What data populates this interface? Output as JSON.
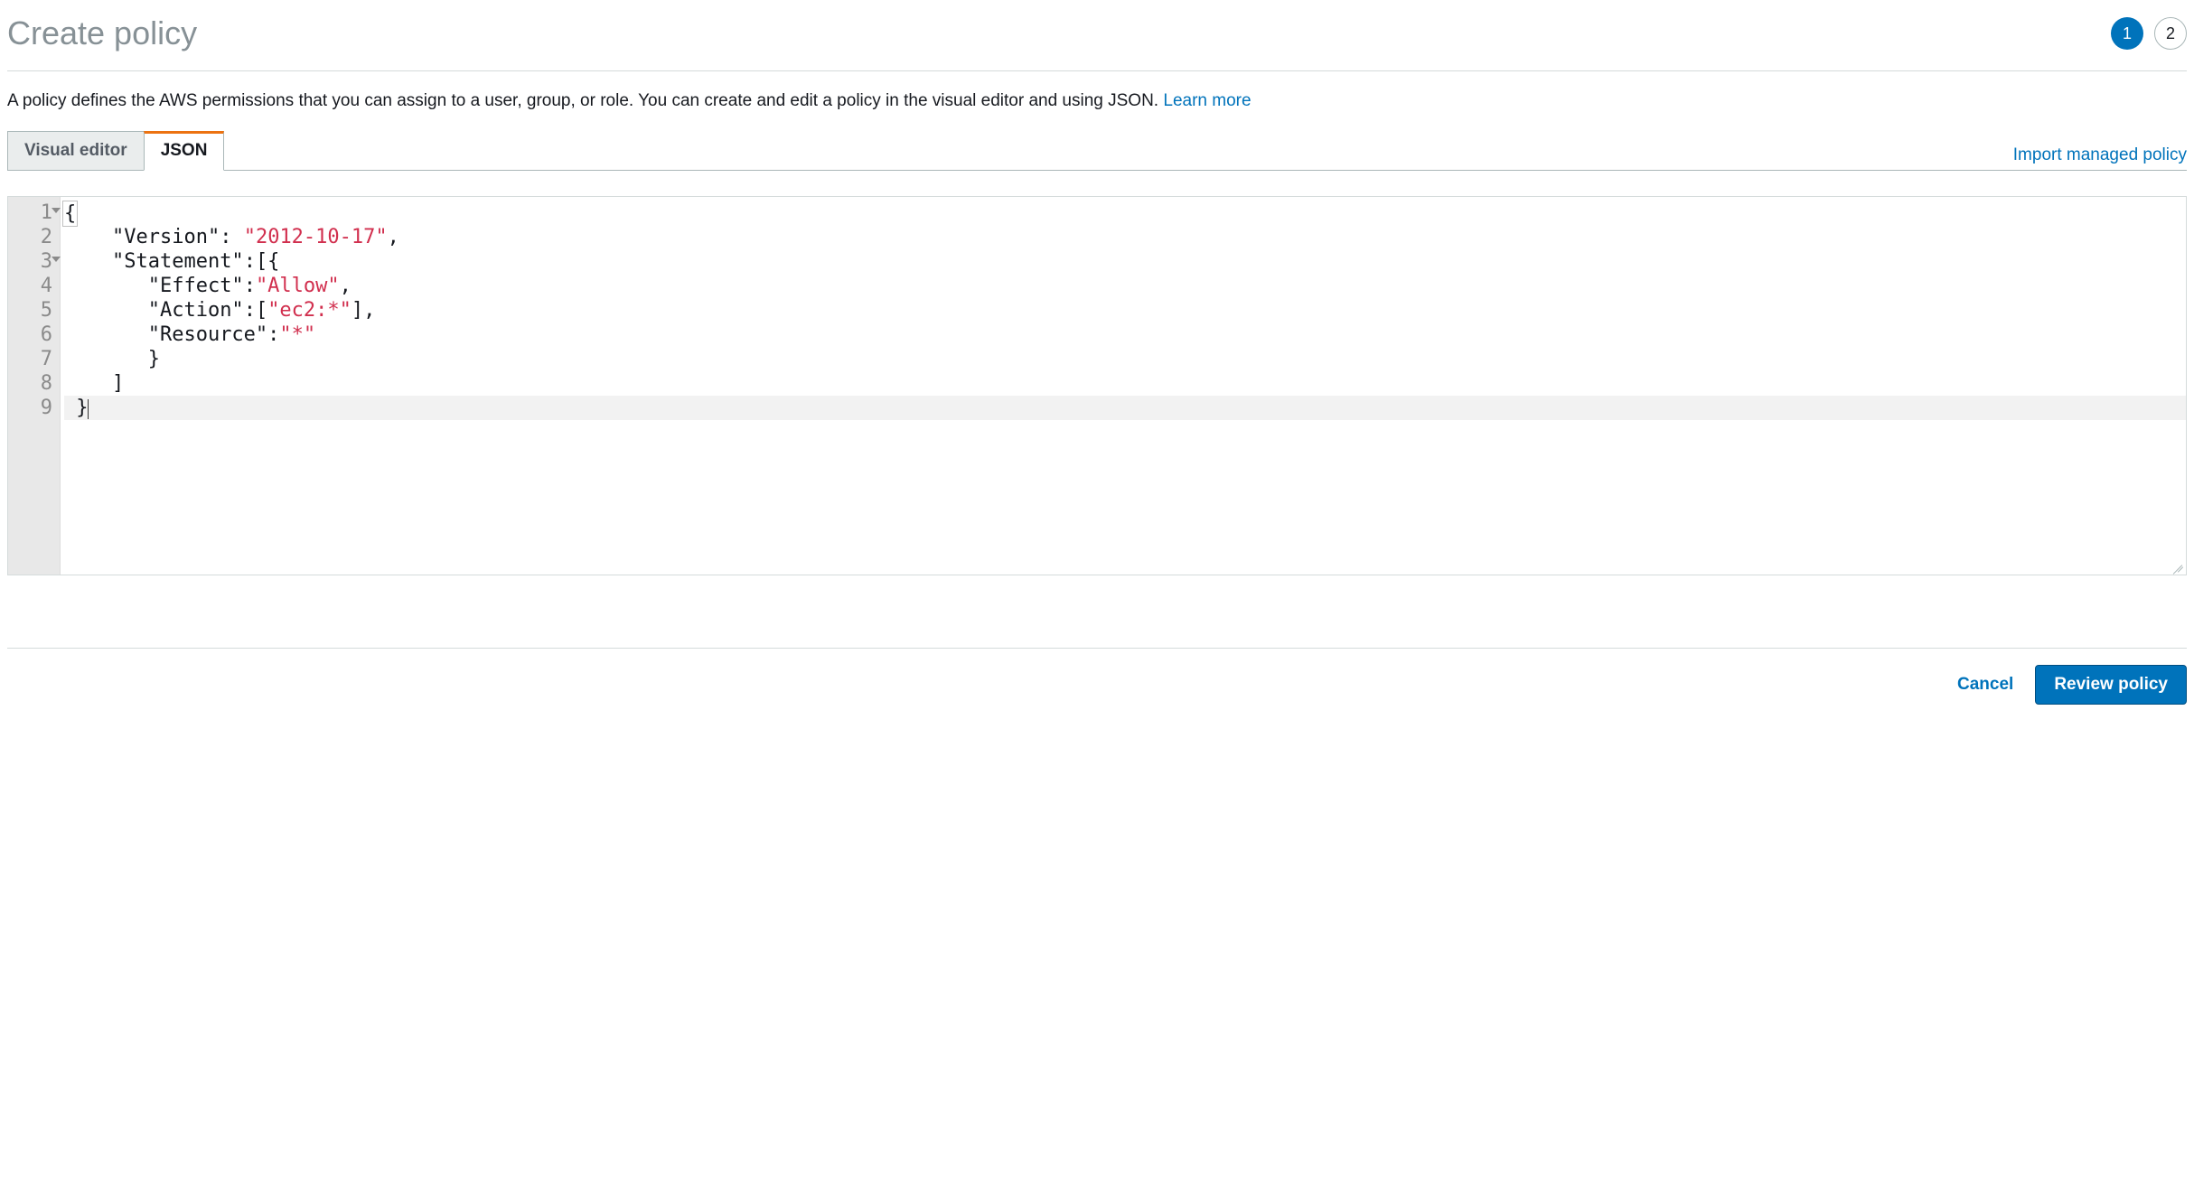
{
  "header": {
    "title": "Create policy",
    "steps": {
      "current": "1",
      "total": "2"
    }
  },
  "description": {
    "text": "A policy defines the AWS permissions that you can assign to a user, group, or role. You can create and edit a policy in the visual editor and using JSON. ",
    "learn_more": "Learn more"
  },
  "tabs": {
    "visual_editor": "Visual editor",
    "json": "JSON",
    "active": "json"
  },
  "import_link": "Import managed policy",
  "editor": {
    "line_numbers": [
      "1",
      "2",
      "3",
      "4",
      "5",
      "6",
      "7",
      "8",
      "9"
    ],
    "fold_lines": [
      1,
      3
    ],
    "policy_json": {
      "Version": "2012-10-17",
      "Statement": [
        {
          "Effect": "Allow",
          "Action": [
            "ec2:*"
          ],
          "Resource": "*"
        }
      ]
    },
    "tokens": {
      "l1_punc": "{",
      "l2_key": "\"Version\"",
      "l2_colon": ": ",
      "l2_val": "\"2012-10-17\"",
      "l2_comma": ",",
      "l3_key": "\"Statement\"",
      "l3_colon": ":",
      "l3_punc": "[{",
      "l4_key": "\"Effect\"",
      "l4_colon": ":",
      "l4_val": "\"Allow\"",
      "l4_comma": ",",
      "l5_key": "\"Action\"",
      "l5_colon": ":",
      "l5_open": "[",
      "l5_val": "\"ec2:*\"",
      "l5_close": "],",
      "l6_key": "\"Resource\"",
      "l6_colon": ":",
      "l6_val": "\"*\"",
      "l7_punc": "}",
      "l8_punc": "]",
      "l9_punc": "}"
    }
  },
  "footer": {
    "cancel": "Cancel",
    "review": "Review policy"
  }
}
